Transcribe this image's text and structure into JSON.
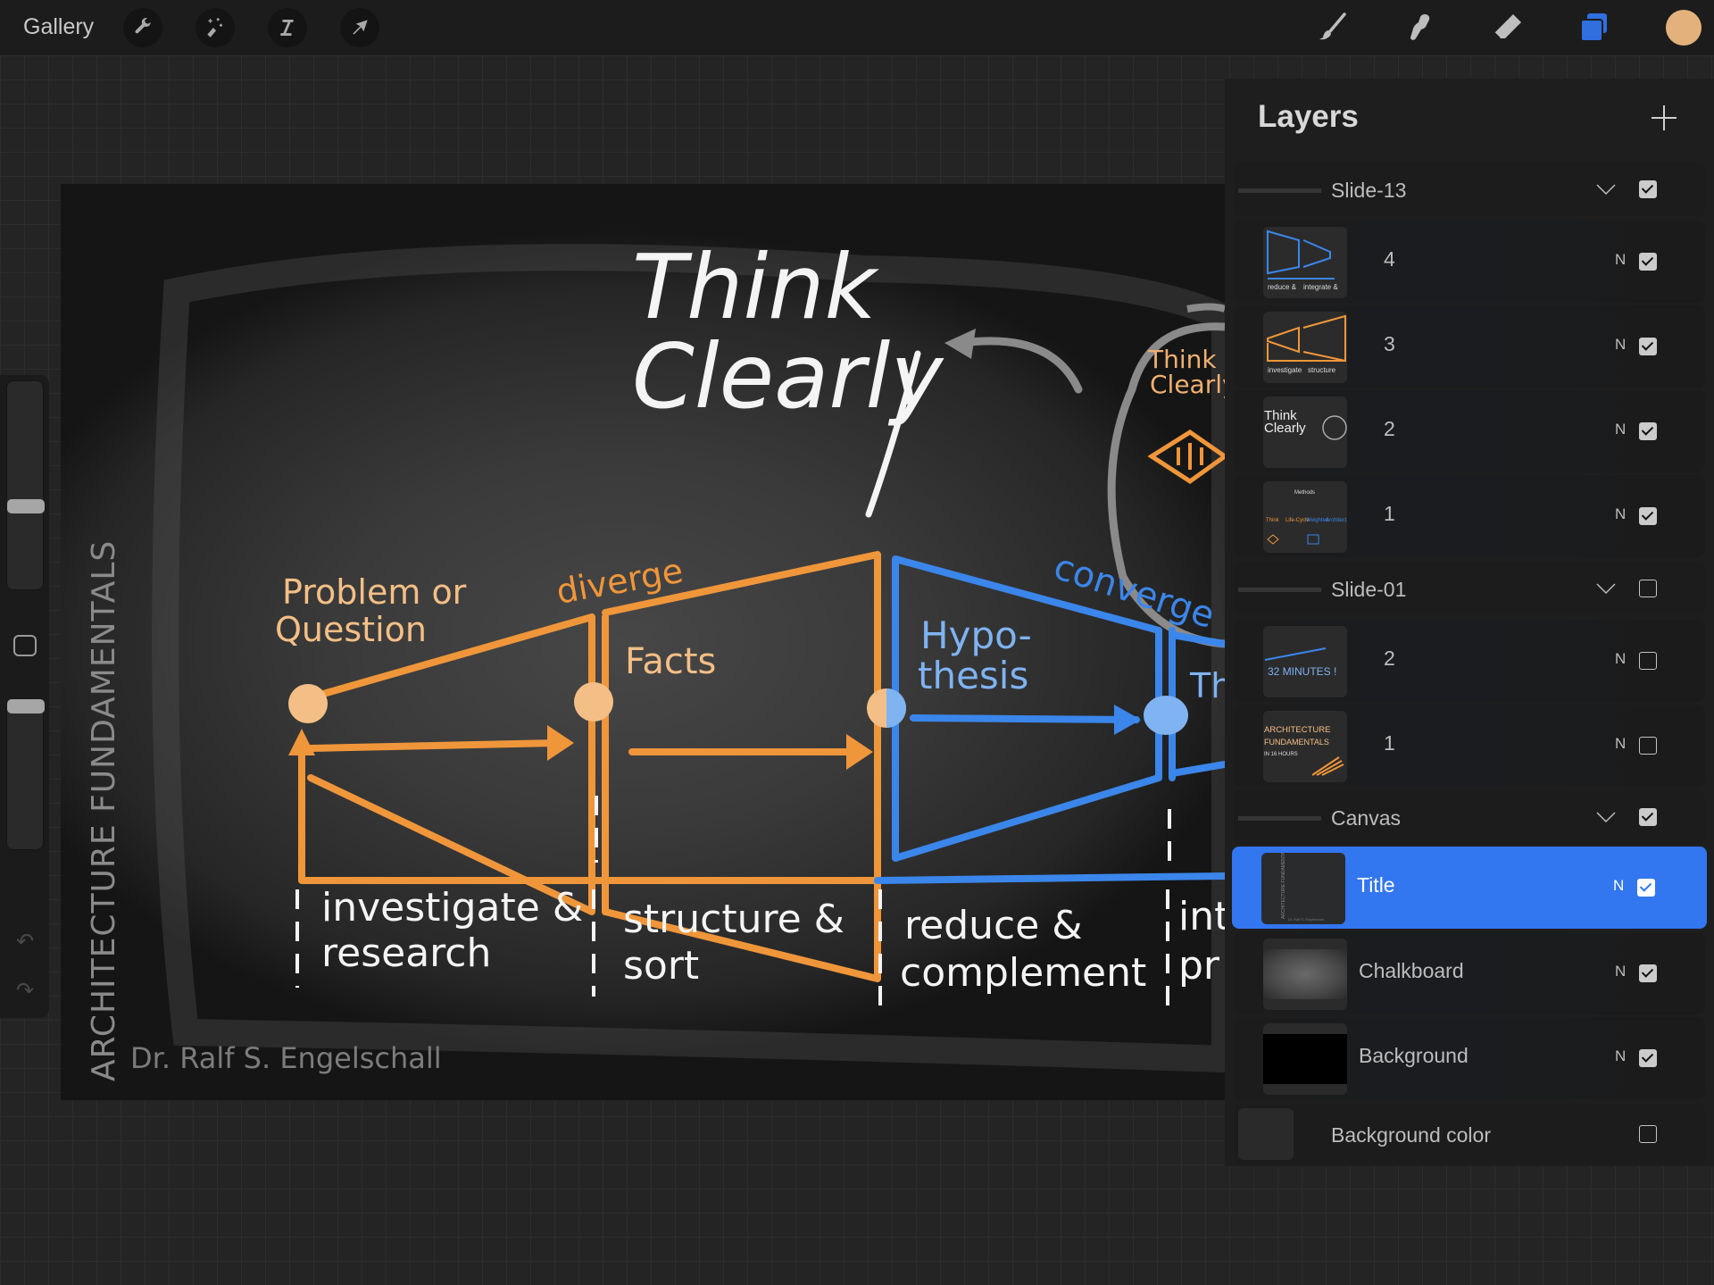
{
  "topbar": {
    "gallery_label": "Gallery",
    "left_tools": [
      {
        "name": "actions",
        "icon": "wrench-icon"
      },
      {
        "name": "adjustments",
        "icon": "magic-wand-icon"
      },
      {
        "name": "selection",
        "icon": "selection-s-icon"
      },
      {
        "name": "transform",
        "icon": "arrow-cursor-icon"
      }
    ],
    "right_tools": [
      {
        "name": "brush",
        "icon": "brush-icon"
      },
      {
        "name": "smudge",
        "icon": "smudge-finger-icon"
      },
      {
        "name": "eraser",
        "icon": "eraser-icon"
      },
      {
        "name": "layers",
        "icon": "layers-icon",
        "active": true,
        "color": "#2f6fe0"
      }
    ],
    "current_color": "#e3b27c"
  },
  "sidebar": {
    "brush_size_fraction": 0.6,
    "opacity_fraction": 1.0,
    "undo_icon": "undo-icon",
    "redo_icon": "redo-icon"
  },
  "canvas": {
    "title_line1": "Think",
    "title_line2": "Clearly",
    "side_title": "ARCHITECTURE FUNDAMENTALS",
    "author": "Dr. Ralf S. Engelschall",
    "labels": {
      "problem1": "Problem or",
      "problem2": "Question",
      "diverge": "diverge",
      "facts": "Facts",
      "converge": "converge",
      "hypo1": "Hypo-",
      "hypo2": "thesis",
      "theory_partial": "Th",
      "small_think1": "Think",
      "small_think2": "Clearly"
    },
    "steps": [
      {
        "line1": "investigate &",
        "line2": "research"
      },
      {
        "line1": "structure &",
        "line2": "sort"
      },
      {
        "line1": "reduce &",
        "line2": "complement"
      },
      {
        "line1": "int",
        "line2": "pr"
      }
    ],
    "colors": {
      "orange": "#f0963a",
      "orange_light": "#f4bf86",
      "blue": "#3b86ea",
      "blue_light": "#7fb3f2",
      "white": "#f4f4f4",
      "grey": "#8a8a8a"
    }
  },
  "layers_panel": {
    "title": "Layers",
    "add_label": "+",
    "blend_mode": "N",
    "groups": [
      {
        "name": "Slide-13",
        "visible": true,
        "layers": [
          {
            "name": "4",
            "visible": true,
            "thumb": "converge-diagram"
          },
          {
            "name": "3",
            "visible": true,
            "thumb": "diverge-diagram"
          },
          {
            "name": "2",
            "visible": true,
            "thumb": "think-clearly"
          },
          {
            "name": "1",
            "visible": true,
            "thumb": "methods-tree"
          }
        ]
      },
      {
        "name": "Slide-01",
        "visible": false,
        "layers": [
          {
            "name": "2",
            "visible": false,
            "thumb": "32-minutes",
            "thumb_text": "32 MINUTES !"
          },
          {
            "name": "1",
            "visible": false,
            "thumb": "architecture-fundamentals",
            "thumb_text": "ARCHITECTURE FUNDAMENTALS",
            "thumb_sub": "IN 16 HOURS"
          }
        ]
      },
      {
        "name": "Canvas",
        "visible": true,
        "layers": [
          {
            "name": "Title",
            "visible": true,
            "selected": true,
            "thumb": "title"
          },
          {
            "name": "Chalkboard",
            "visible": true,
            "thumb": "chalkboard"
          },
          {
            "name": "Background",
            "visible": true,
            "thumb": "black"
          }
        ]
      }
    ],
    "background_color": {
      "label": "Background color",
      "visible": false
    }
  }
}
